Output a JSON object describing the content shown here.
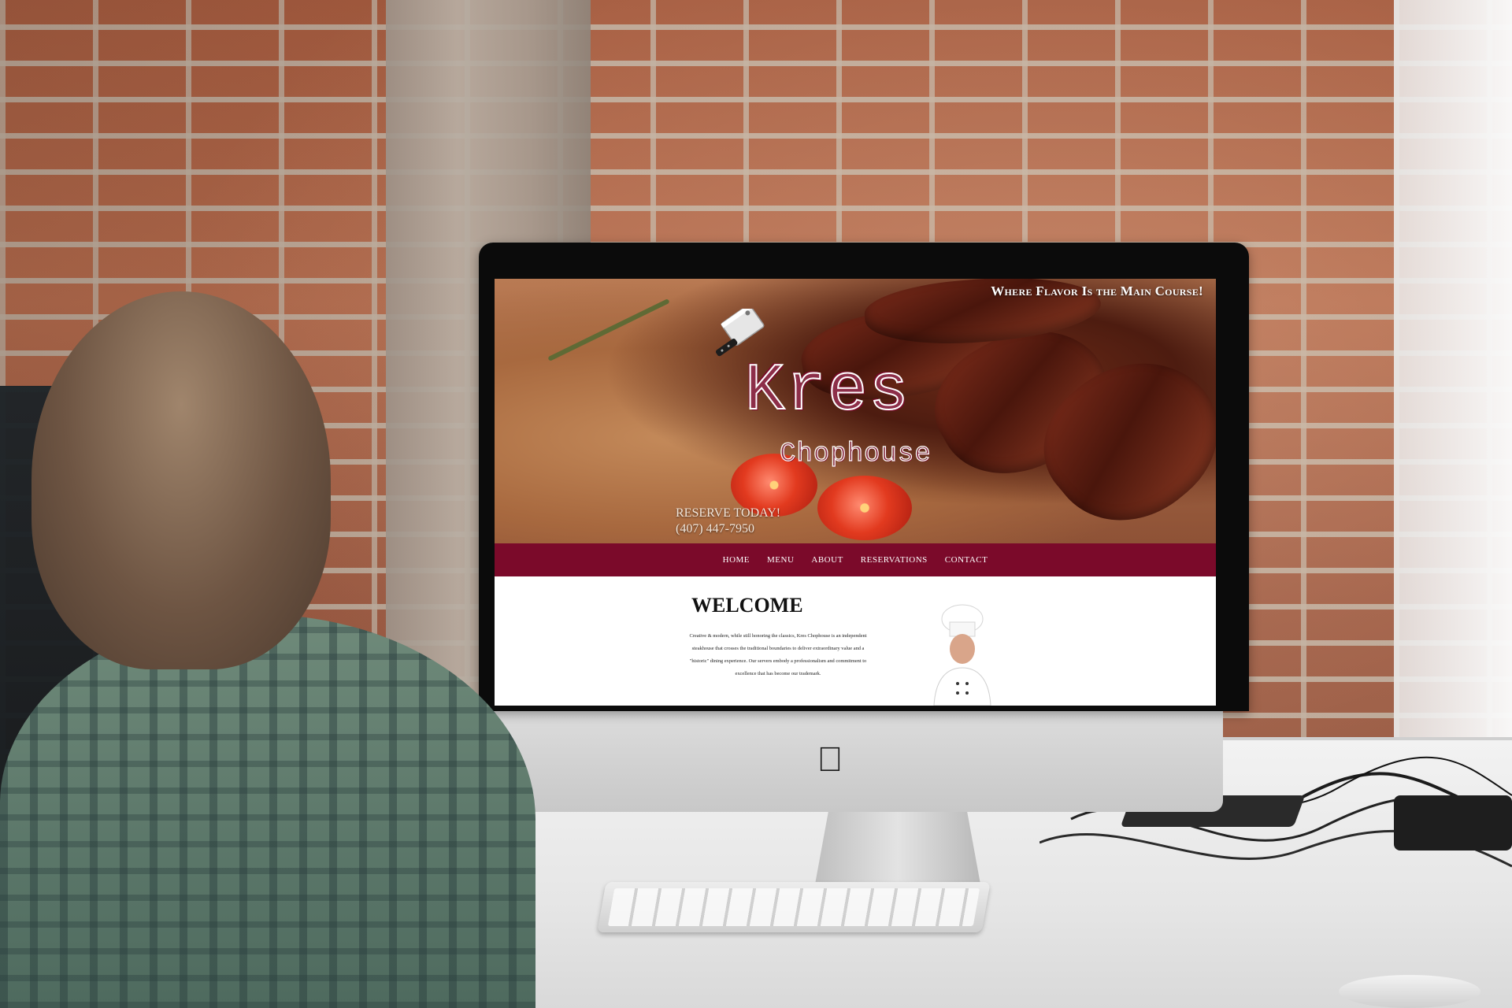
{
  "site": {
    "tagline": "Where Flavor Is the Main Course!",
    "brand_main": "Kres",
    "brand_sub": "Chophouse",
    "reserve_line1": "RESERVE TODAY!",
    "reserve_line2": "(407) 447-7950"
  },
  "nav": {
    "items": [
      {
        "label": "HOME"
      },
      {
        "label": "MENU"
      },
      {
        "label": "ABOUT"
      },
      {
        "label": "RESERVATIONS"
      },
      {
        "label": "CONTACT"
      }
    ]
  },
  "main": {
    "heading": "WELCOME",
    "intro": "Creative & modern, while still honoring the classics, Kres Chophouse is an independent steakhouse that crosses the traditional boundaries to deliver extraordinary value and a \"historic\" dining experience. Our servers embody a professionalism and commitment to excellence that has become our trademark."
  },
  "colors": {
    "nav_bar": "#7b0a2a",
    "brand_outline": "#7a0a2a",
    "page_bg": "#ffffff"
  },
  "icons": {
    "cleaver": "cleaver-icon",
    "apple": "apple-logo-icon"
  }
}
